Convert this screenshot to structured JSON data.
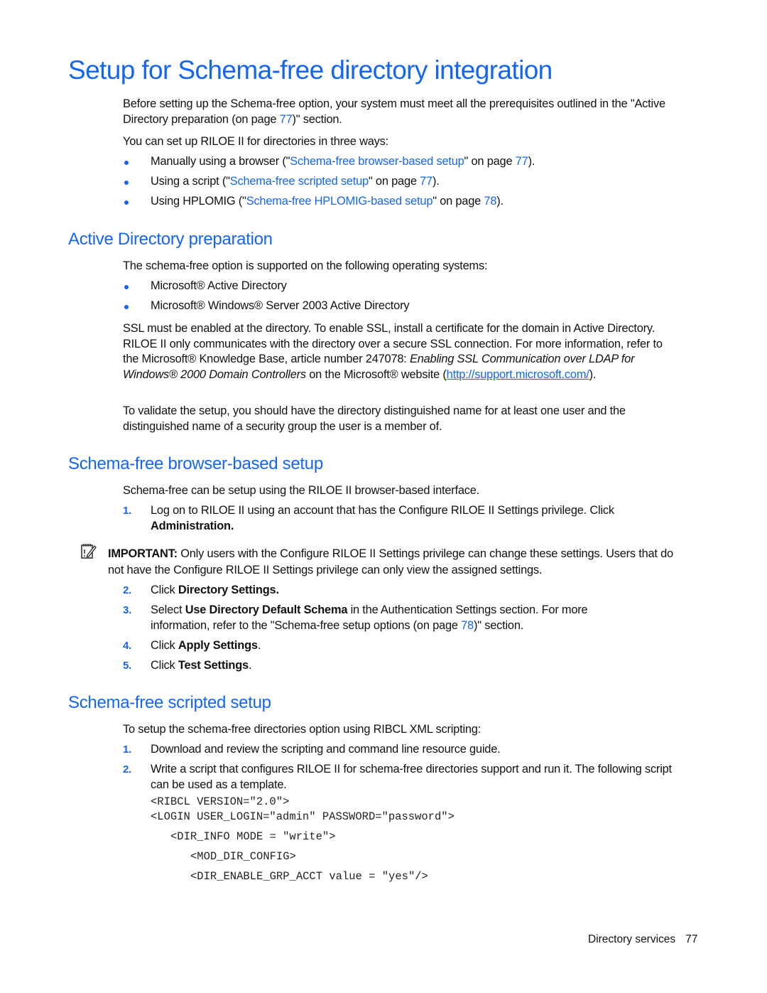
{
  "title": "Setup for Schema-free directory integration",
  "intro": {
    "p1_before": "Before setting up the Schema-free option, your system must meet all the prerequisites outlined in the \"Active Directory preparation (on page ",
    "p1_page": "77",
    "p1_after": ")\" section.",
    "p2": "You can set up RILOE II for directories in three ways:",
    "ways": [
      {
        "before": "Manually using a browser (\"",
        "link": "Schema-free browser-based setup",
        "mid": "\" on page ",
        "page": "77",
        "after": ")."
      },
      {
        "before": "Using a script (\"",
        "link": "Schema-free scripted setup",
        "mid": "\" on page ",
        "page": "77",
        "after": ")."
      },
      {
        "before": "Using HPLOMIG (\"",
        "link": "Schema-free HPLOMIG-based setup",
        "mid": "\" on page ",
        "page": "78",
        "after": ")."
      }
    ]
  },
  "ad_prep": {
    "heading": "Active Directory preparation",
    "p1": "The schema-free option is supported on the following operating systems:",
    "os": [
      "Microsoft® Active Directory",
      "Microsoft® Windows® Server 2003 Active Directory"
    ],
    "ssl_before": "SSL must be enabled at the directory. To enable SSL, install a certificate for the domain in Active Directory. RILOE II only communicates with the directory over a secure SSL connection. For more information, refer to the Microsoft® Knowledge Base, article number 247078: ",
    "ssl_italic": "Enabling SSL Communication over LDAP for Windows® 2000 Domain Controllers",
    "ssl_after": " on the Microsoft® website (",
    "ssl_link": "http://support.microsoft.com/",
    "ssl_end": ").",
    "validate": "To validate the setup, you should have the directory distinguished name for at least one user and the distinguished name of a security group the user is a member of."
  },
  "browser_setup": {
    "heading": "Schema-free browser-based setup",
    "p1": "Schema-free can be setup using the RILOE II browser-based interface.",
    "step1_num": "1.",
    "step1_text": "Log on to RILOE II using an account that has the Configure RILOE II Settings privilege. Click ",
    "step1_bold": "Administration.",
    "important_label": "IMPORTANT:",
    "important_text": " Only users with the Configure RILOE II Settings privilege can change these settings. Users that do not have the Configure RILOE II Settings privilege can only view the assigned settings.",
    "step2_num": "2.",
    "step2_text": "Click ",
    "step2_bold": "Directory Settings.",
    "step3_num": "3.",
    "step3_text": "Select ",
    "step3_bold": "Use Directory Default Schema",
    "step3_after": " in the Authentication Settings section. For more information, refer to the \"Schema-free setup options (on page ",
    "step3_page": "78",
    "step3_end": ")\" section.",
    "step4_num": "4.",
    "step4_text": "Click ",
    "step4_bold": "Apply Settings",
    "step4_end": ".",
    "step5_num": "5.",
    "step5_text": "Click ",
    "step5_bold": "Test Settings",
    "step5_end": "."
  },
  "scripted_setup": {
    "heading": "Schema-free scripted setup",
    "p1": "To setup the schema-free directories option using RIBCL XML scripting:",
    "step1_num": "1.",
    "step1_text": "Download and review the scripting and command line resource guide.",
    "step2_num": "2.",
    "step2_text": "Write a script that configures RILOE II for schema-free directories support and run it. The following script can be used as a template.",
    "code": [
      "<RIBCL VERSION=\"2.0\">",
      "<LOGIN USER_LOGIN=\"admin\" PASSWORD=\"password\">",
      "<DIR_INFO MODE = \"write\">",
      "<MOD_DIR_CONFIG>",
      "<DIR_ENABLE_GRP_ACCT value = \"yes\"/>"
    ]
  },
  "footer": {
    "section": "Directory services",
    "page": "77"
  }
}
